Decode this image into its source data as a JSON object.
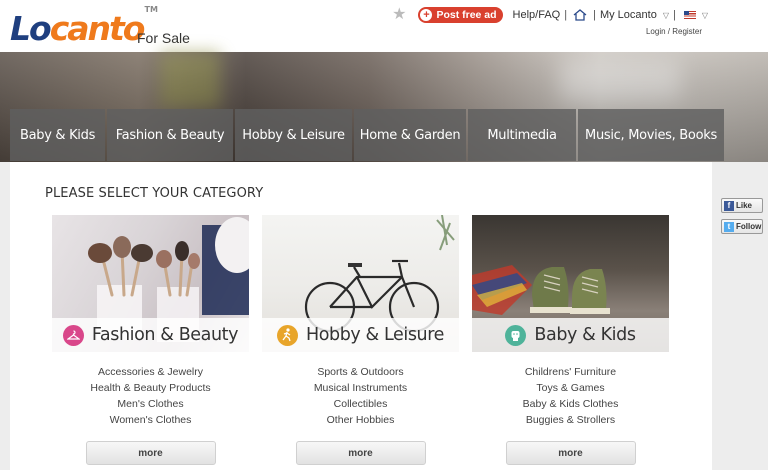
{
  "header": {
    "logo_part1": "Lo",
    "logo_part2": "canto",
    "logo_tm": "TM",
    "section": "For Sale",
    "post_ad_label": "Post free ad",
    "help_label": "Help/FAQ",
    "my_account_label": "My Locanto",
    "login_label": "Login / Register"
  },
  "category_tabs": [
    {
      "label": "Baby & Kids"
    },
    {
      "label": "Fashion & Beauty"
    },
    {
      "label": "Hobby & Leisure"
    },
    {
      "label": "Home & Garden"
    },
    {
      "label": "Multimedia"
    },
    {
      "label": "Music, Movies, Books"
    }
  ],
  "main": {
    "heading": "PLEASE SELECT YOUR CATEGORY",
    "cards": [
      {
        "title": "Fashion & Beauty",
        "icon": "hanger-icon",
        "icon_color": "#d9478a",
        "subcategories": [
          "Accessories & Jewelry",
          "Health & Beauty Products",
          "Men's Clothes",
          "Women's Clothes"
        ],
        "more_label": "more"
      },
      {
        "title": "Hobby & Leisure",
        "icon": "runner-icon",
        "icon_color": "#e8a52a",
        "subcategories": [
          "Sports & Outdoors",
          "Musical Instruments",
          "Collectibles",
          "Other Hobbies"
        ],
        "more_label": "more"
      },
      {
        "title": "Baby & Kids",
        "icon": "baby-icon",
        "icon_color": "#4fb39a",
        "subcategories": [
          "Childrens' Furniture",
          "Toys & Games",
          "Baby & Kids Clothes",
          "Buggies & Strollers"
        ],
        "more_label": "more"
      }
    ]
  },
  "social": {
    "like_label": "Like",
    "follow_label": "Follow"
  },
  "colors": {
    "logo_blue": "#1f3f7f",
    "logo_orange": "#ef7a1c",
    "post_button": "#d9402e"
  }
}
